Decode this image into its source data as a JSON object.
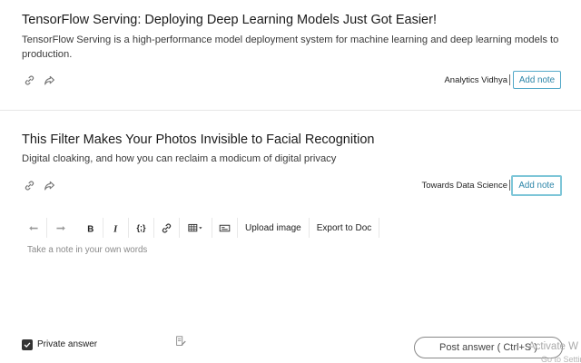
{
  "articles": [
    {
      "title": "TensorFlow Serving: Deploying Deep Learning Models Just Got Easier!",
      "description": "TensorFlow Serving is a high-performance model deployment system for machine learning and deep learning models to production.",
      "source": "Analytics Vidhya",
      "add_note_label": "Add note"
    },
    {
      "title": "This Filter Makes Your Photos Invisible to Facial Recognition",
      "description": "Digital cloaking, and how you can reclaim a modicum of digital privacy",
      "source": "Towards Data Science",
      "add_note_label": "Add note"
    }
  ],
  "editor": {
    "toolbar": {
      "upload_image_label": "Upload image",
      "export_label": "Export to Doc",
      "code_label": "{;}"
    },
    "placeholder": "Take a note in your own words"
  },
  "footer": {
    "private_label": "Private answer",
    "private_checked": true,
    "post_label": "Post answer ( Ctrl+S )"
  },
  "watermark": {
    "line1": "Activate W",
    "line2": "Go to Settin"
  },
  "colors": {
    "accent": "#2c85a8",
    "accent_border": "#52a8c8",
    "focus_border": "#7ec6d8"
  }
}
